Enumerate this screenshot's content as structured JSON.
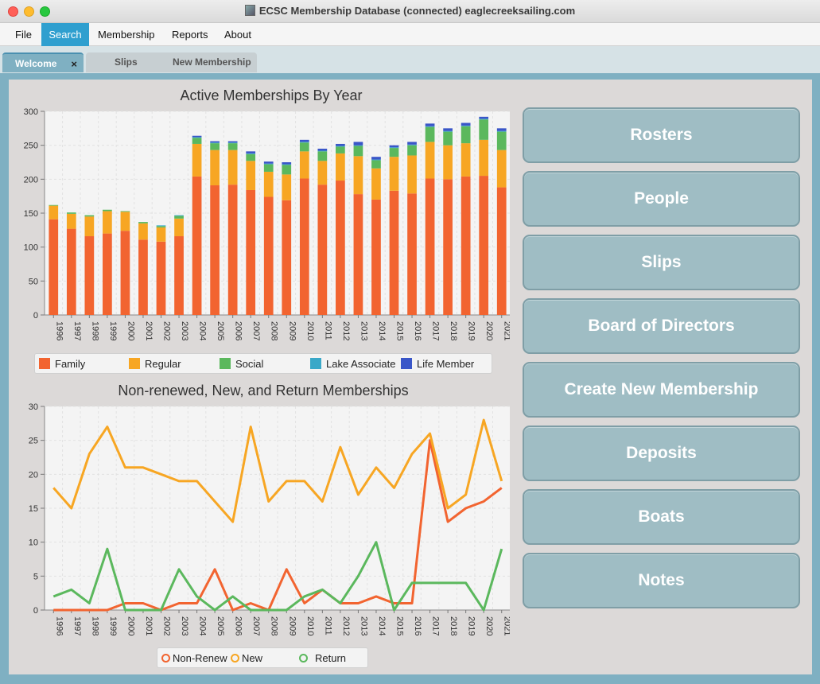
{
  "window": {
    "title": "ECSC Membership Database (connected) eaglecreeksailing.com"
  },
  "menu": [
    "File",
    "Search",
    "Membership",
    "Reports",
    "About"
  ],
  "tabs": [
    {
      "label": "Welcome",
      "active": true,
      "close": "×"
    },
    {
      "label": "Slips"
    },
    {
      "label": "New Membership"
    }
  ],
  "buttons": [
    "Rosters",
    "People",
    "Slips",
    "Board of Directors",
    "Create New Membership",
    "Deposits",
    "Boats",
    "Notes"
  ],
  "colors": {
    "accent": "#2f9fcf",
    "tab_active": "#7fb0c2",
    "button": "#9fbdc4"
  },
  "chart_data": [
    {
      "type": "bar",
      "stacked": true,
      "title": "Active Memberships By Year",
      "categories": [
        "1996",
        "1997",
        "1998",
        "1999",
        "2000",
        "2001",
        "2002",
        "2003",
        "2004",
        "2005",
        "2006",
        "2007",
        "2008",
        "2009",
        "2010",
        "2011",
        "2012",
        "2013",
        "2014",
        "2015",
        "2016",
        "2017",
        "2018",
        "2019",
        "2020",
        "2021"
      ],
      "ylim": [
        0,
        300
      ],
      "yticks": [
        0,
        50,
        100,
        150,
        200,
        250,
        300
      ],
      "grid": true,
      "legend": "bottom",
      "series": [
        {
          "name": "Family",
          "color": "#f26430",
          "values": [
            141,
            127,
            116,
            120,
            124,
            111,
            108,
            116,
            204,
            191,
            192,
            184,
            174,
            169,
            201,
            192,
            198,
            178,
            170,
            183,
            179,
            201,
            200,
            204,
            205,
            188
          ]
        },
        {
          "name": "Regular",
          "color": "#f7a623",
          "values": [
            20,
            22,
            29,
            33,
            28,
            24,
            21,
            26,
            48,
            52,
            51,
            43,
            37,
            38,
            40,
            35,
            40,
            56,
            46,
            50,
            56,
            54,
            50,
            49,
            53,
            55
          ]
        },
        {
          "name": "Social",
          "color": "#5bb85d",
          "values": [
            1,
            2,
            2,
            2,
            1,
            2,
            2,
            4,
            9,
            10,
            10,
            10,
            11,
            14,
            13,
            14,
            10,
            15,
            12,
            13,
            15,
            22,
            20,
            25,
            30,
            27
          ]
        },
        {
          "name": "Lake Associate",
          "color": "#3aa8c8",
          "values": [
            0,
            0,
            0,
            0,
            0,
            0,
            1,
            1,
            1,
            1,
            1,
            1,
            1,
            1,
            1,
            1,
            1,
            1,
            1,
            1,
            1,
            1,
            1,
            1,
            1,
            1
          ]
        },
        {
          "name": "Life Member",
          "color": "#3a56c8",
          "values": [
            0,
            0,
            0,
            0,
            0,
            0,
            0,
            0,
            2,
            2,
            2,
            3,
            3,
            3,
            3,
            3,
            3,
            5,
            4,
            3,
            4,
            4,
            4,
            4,
            3,
            4
          ]
        }
      ]
    },
    {
      "type": "line",
      "title": "Non-renewed, New, and Return Memberships",
      "categories": [
        "1996",
        "1997",
        "1998",
        "1999",
        "2000",
        "2001",
        "2002",
        "2003",
        "2004",
        "2005",
        "2006",
        "2007",
        "2008",
        "2009",
        "2010",
        "2011",
        "2012",
        "2013",
        "2014",
        "2015",
        "2016",
        "2017",
        "2018",
        "2019",
        "2020",
        "2021"
      ],
      "ylim": [
        0,
        30
      ],
      "yticks": [
        0,
        5,
        10,
        15,
        20,
        25,
        30
      ],
      "grid": true,
      "legend": "bottom",
      "series": [
        {
          "name": "Non-Renew",
          "color": "#f26430",
          "values": [
            0,
            0,
            0,
            0,
            1,
            1,
            0,
            1,
            1,
            6,
            0,
            1,
            0,
            6,
            1,
            3,
            1,
            1,
            2,
            1,
            1,
            25,
            13,
            15,
            16,
            18
          ]
        },
        {
          "name": "New",
          "color": "#f7a623",
          "values": [
            18,
            15,
            23,
            27,
            21,
            21,
            20,
            19,
            19,
            16,
            13,
            27,
            16,
            19,
            19,
            16,
            24,
            17,
            21,
            18,
            23,
            26,
            15,
            17,
            28,
            19
          ]
        },
        {
          "name": "Return",
          "color": "#5bb85d",
          "values": [
            2,
            3,
            1,
            9,
            0,
            0,
            0,
            6,
            2,
            0,
            2,
            0,
            0,
            0,
            2,
            3,
            1,
            5,
            10,
            0,
            4,
            4,
            4,
            4,
            0,
            9
          ]
        }
      ]
    }
  ]
}
